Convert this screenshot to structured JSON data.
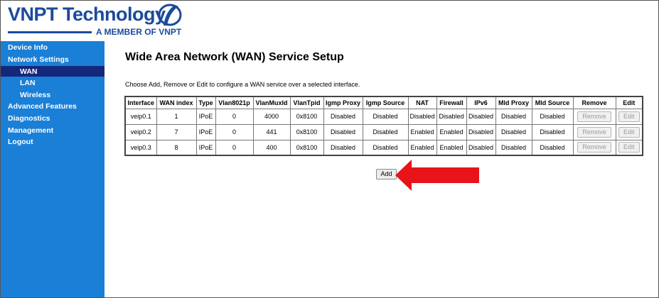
{
  "brand": {
    "name": "VNPT Technology",
    "tagline": "A MEMBER OF VNPT",
    "color": "#1b4a9c"
  },
  "sidebar": {
    "bg": "#1a7fd6",
    "active_bg": "#15277a",
    "items": [
      {
        "label": "Device Info"
      },
      {
        "label": "Network Settings"
      },
      {
        "label": "WAN"
      },
      {
        "label": "LAN"
      },
      {
        "label": "Wireless"
      },
      {
        "label": "Advanced Features"
      },
      {
        "label": "Diagnostics"
      },
      {
        "label": "Management"
      },
      {
        "label": "Logout"
      }
    ]
  },
  "main": {
    "title": "Wide Area Network (WAN) Service Setup",
    "description": "Choose Add, Remove or Edit to configure a WAN service over a selected interface.",
    "columns": [
      "Interface",
      "WAN index",
      "Type",
      "Vlan8021p",
      "VlanMuxId",
      "VlanTpid",
      "Igmp Proxy",
      "Igmp Source",
      "NAT",
      "Firewall",
      "IPv6",
      "Mld Proxy",
      "Mld Source",
      "Remove",
      "Edit"
    ],
    "rows": [
      {
        "cells": [
          "veip0.1",
          "1",
          "IPoE",
          "0",
          "4000",
          "0x8100",
          "Disabled",
          "Disabled",
          "Disabled",
          "Disabled",
          "Disabled",
          "Disabled",
          "Disabled"
        ],
        "remove": "Remove",
        "edit": "Edit"
      },
      {
        "cells": [
          "veip0.2",
          "7",
          "IPoE",
          "0",
          "441",
          "0x8100",
          "Disabled",
          "Disabled",
          "Enabled",
          "Enabled",
          "Disabled",
          "Disabled",
          "Disabled"
        ],
        "remove": "Remove",
        "edit": "Edit"
      },
      {
        "cells": [
          "veip0.3",
          "8",
          "IPoE",
          "0",
          "400",
          "0x8100",
          "Disabled",
          "Disabled",
          "Enabled",
          "Enabled",
          "Disabled",
          "Disabled",
          "Disabled"
        ],
        "remove": "Remove",
        "edit": "Edit"
      }
    ],
    "add_label": "Add"
  },
  "annotation": {
    "arrow_color": "#e8141a",
    "arrow_icon": "red-arrow-left-icon"
  }
}
